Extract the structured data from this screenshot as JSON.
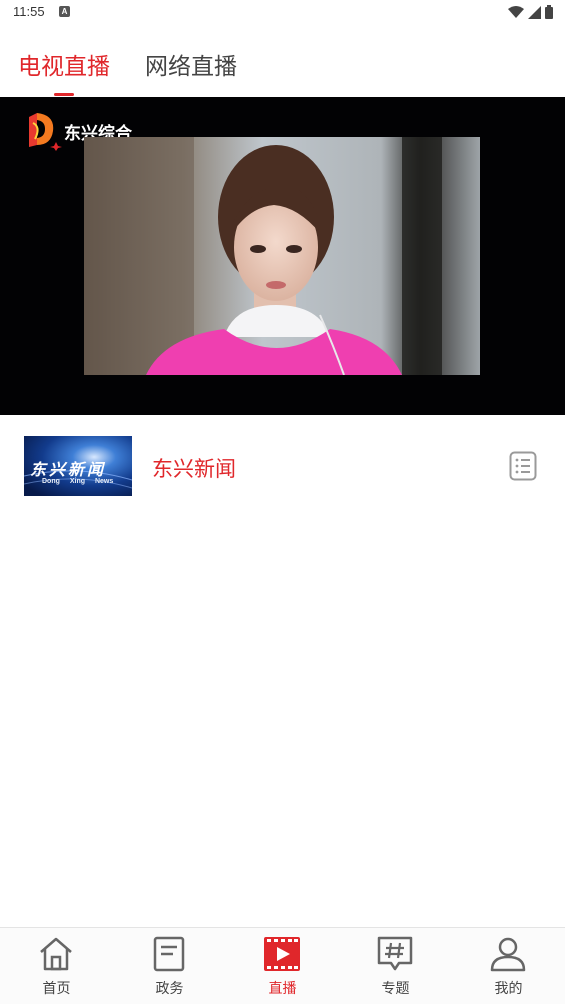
{
  "status_bar": {
    "time": "11:55",
    "notification_icon": "a-icon",
    "indicators": [
      "wifi-icon",
      "signal-icon",
      "battery-icon"
    ]
  },
  "tabs": [
    {
      "label": "电视直播",
      "active": true
    },
    {
      "label": "网络直播",
      "active": false
    }
  ],
  "player": {
    "channel_name": "东兴综合",
    "channel_logo_icon": "channel-logo-icon"
  },
  "programs": [
    {
      "title": "东兴新闻",
      "thumb_title": "东兴新闻",
      "thumb_subtitle": "Dong Xing News",
      "action_icon": "list-icon"
    }
  ],
  "bottom_nav": [
    {
      "label": "首页",
      "icon": "home-icon",
      "active": false
    },
    {
      "label": "政务",
      "icon": "document-icon",
      "active": false
    },
    {
      "label": "直播",
      "icon": "live-play-icon",
      "active": true
    },
    {
      "label": "专题",
      "icon": "hashtag-icon",
      "active": false
    },
    {
      "label": "我的",
      "icon": "user-icon",
      "active": false
    }
  ],
  "colors": {
    "accent": "#e0272b",
    "player_background": "#020204",
    "nav_background": "#fbfbfb"
  }
}
